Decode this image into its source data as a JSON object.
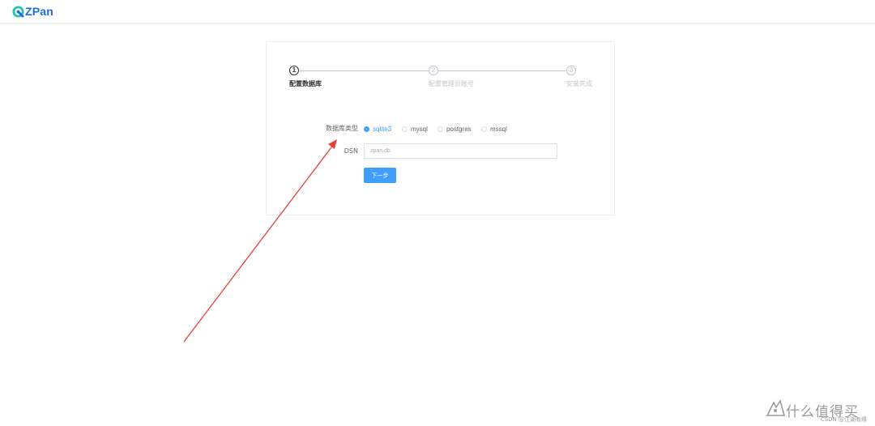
{
  "app": {
    "logo_text": "ZPan",
    "icon": "zpan-logo-icon",
    "accent_color": "#409eff",
    "brand_color": "#1f6fd6"
  },
  "steps": [
    {
      "number": "1",
      "label": "配置数据库",
      "active": true
    },
    {
      "number": "2",
      "label": "配置管理员账号",
      "active": false
    },
    {
      "number": "3",
      "label": "安装完成",
      "active": false
    }
  ],
  "form": {
    "db_type_label": "数据库类型",
    "db_options": [
      {
        "label": "sqlite3",
        "checked": true
      },
      {
        "label": "mysql",
        "checked": false
      },
      {
        "label": "postgres",
        "checked": false
      },
      {
        "label": "mssql",
        "checked": false
      }
    ],
    "dsn_label": "DSN",
    "dsn_placeholder": "zpan.db",
    "dsn_value": "",
    "next_button": "下一步"
  },
  "annotation": {
    "arrow_color": "#e8413c",
    "icon": "red-arrow-annotation"
  },
  "watermark": {
    "brand_text": "什么值得买",
    "sub_text": "CSDN @江湖有缘",
    "icon": "smzdm-logo-icon"
  }
}
